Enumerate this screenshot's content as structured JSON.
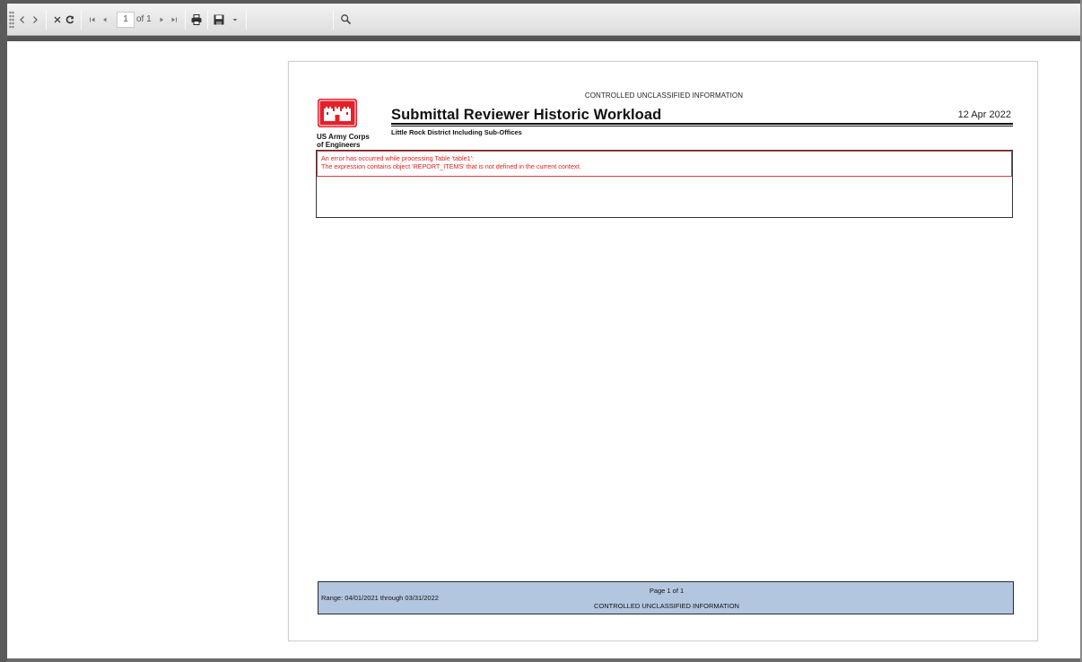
{
  "toolbar": {
    "page_current": "1",
    "page_of": "of 1",
    "icons": [
      "toolbar-grip",
      "back-icon",
      "forward-icon",
      "stop-icon",
      "refresh-icon",
      "first-page-icon",
      "prev-page-icon",
      "next-page-icon",
      "last-page-icon",
      "print-icon",
      "export-save-icon",
      "dropdown-arrow-icon",
      "find-icon"
    ]
  },
  "report": {
    "classification_top": "CONTROLLED UNCLASSIFIED INFORMATION",
    "title": "Submittal Reviewer Historic Workload",
    "subtitle": "Little Rock District Including Sub-Offices",
    "date": "12 Apr 2022",
    "logo_caption_line1": "US Army Corps",
    "logo_caption_line2": "of Engineers",
    "error": {
      "line1": "An error has occurred while processing Table 'table1':",
      "line2": "The expression contains object 'REPORT_ITEMS' that is not defined in the current context."
    },
    "footer": {
      "range": "Range: 04/01/2021 through 03/31/2022",
      "page": "Page 1 of 1",
      "classification": "CONTROLLED UNCLASSIFIED INFORMATION"
    }
  },
  "colors": {
    "error_red": "#e02020",
    "footer_fill": "#b3c6df",
    "logo_red": "#e4202a"
  }
}
